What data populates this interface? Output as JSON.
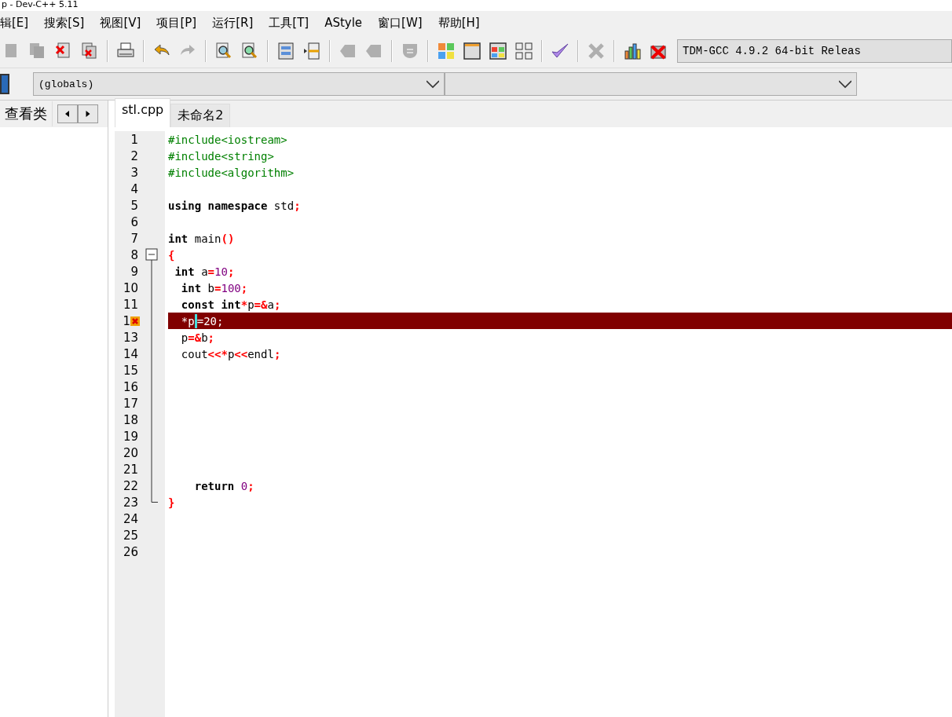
{
  "window": {
    "title": "p - Dev-C++ 5.11"
  },
  "menu": [
    "辑[E]",
    "搜索[S]",
    "视图[V]",
    "项目[P]",
    "运行[R]",
    "工具[T]",
    "AStyle",
    "窗口[W]",
    "帮助[H]"
  ],
  "toolbar": [
    {
      "kind": "page",
      "disabled": true
    },
    {
      "kind": "pages",
      "disabled": true
    },
    {
      "kind": "close-page",
      "disabled": false
    },
    {
      "kind": "close-pages",
      "disabled": false
    },
    {
      "kind": "sep"
    },
    {
      "kind": "printer",
      "disabled": false
    },
    {
      "kind": "sep"
    },
    {
      "kind": "undo",
      "disabled": false
    },
    {
      "kind": "redo",
      "disabled": true
    },
    {
      "kind": "sep"
    },
    {
      "kind": "search",
      "disabled": false
    },
    {
      "kind": "replace",
      "disabled": false
    },
    {
      "kind": "sep"
    },
    {
      "kind": "panels",
      "disabled": false
    },
    {
      "kind": "unindent",
      "disabled": false
    },
    {
      "kind": "sep"
    },
    {
      "kind": "tag",
      "disabled": true
    },
    {
      "kind": "tag",
      "disabled": true
    },
    {
      "kind": "sep"
    },
    {
      "kind": "shield",
      "disabled": true
    },
    {
      "kind": "sep"
    },
    {
      "kind": "tiles",
      "disabled": false
    },
    {
      "kind": "window",
      "disabled": false
    },
    {
      "kind": "color-tiles",
      "disabled": false
    },
    {
      "kind": "grid",
      "disabled": false
    },
    {
      "kind": "sep"
    },
    {
      "kind": "check",
      "disabled": false
    },
    {
      "kind": "sep"
    },
    {
      "kind": "cross",
      "disabled": true
    },
    {
      "kind": "sep"
    },
    {
      "kind": "chart",
      "disabled": false
    },
    {
      "kind": "stop",
      "disabled": false
    }
  ],
  "compiler": "TDM-GCC 4.9.2 64-bit Releas",
  "scope_combo": "(globals)",
  "left_panel": {
    "tab": "查看类"
  },
  "editor_tabs": [
    {
      "label": "stl.cpp",
      "selected": true
    },
    {
      "label": "未命名2",
      "selected": false
    }
  ],
  "lines": [
    {
      "number": "1",
      "tokens": [
        {
          "kind": "pre",
          "text": "#include<iostream>"
        }
      ]
    },
    {
      "number": "2",
      "tokens": [
        {
          "kind": "pre",
          "text": "#include<string>"
        }
      ]
    },
    {
      "number": "3",
      "tokens": [
        {
          "kind": "pre",
          "text": "#include<algorithm>"
        }
      ]
    },
    {
      "number": "4"
    },
    {
      "number": "5",
      "tokens": [
        {
          "kind": "kw",
          "text": "using namespace"
        },
        {
          "kind": "id",
          "text": " std"
        },
        {
          "kind": "op",
          "text": ";"
        }
      ]
    },
    {
      "number": "6"
    },
    {
      "number": "7",
      "tokens": [
        {
          "kind": "kw",
          "text": "int"
        },
        {
          "kind": "id",
          "text": " main"
        },
        {
          "kind": "op",
          "text": "()"
        }
      ]
    },
    {
      "number": "8",
      "fold_start": true,
      "tokens": [
        {
          "kind": "op",
          "text": "{"
        }
      ]
    },
    {
      "number": "9",
      "tokens": [
        {
          "kind": "kw",
          "text": " int"
        },
        {
          "kind": "id",
          "text": " a"
        },
        {
          "kind": "op",
          "text": "="
        },
        {
          "kind": "num",
          "text": "10"
        },
        {
          "kind": "op",
          "text": ";"
        }
      ]
    },
    {
      "number": "10",
      "tokens": [
        {
          "kind": "kw",
          "text": "  int"
        },
        {
          "kind": "id",
          "text": " b"
        },
        {
          "kind": "op",
          "text": "="
        },
        {
          "kind": "num",
          "text": "100"
        },
        {
          "kind": "op",
          "text": ";"
        }
      ]
    },
    {
      "number": "11",
      "tokens": [
        {
          "kind": "kw",
          "text": "  const int"
        },
        {
          "kind": "op",
          "text": "*"
        },
        {
          "kind": "id",
          "text": "p"
        },
        {
          "kind": "op",
          "text": "=&"
        },
        {
          "kind": "id",
          "text": "a"
        },
        {
          "kind": "op",
          "text": ";"
        }
      ]
    },
    {
      "number": "1",
      "error": true,
      "tokens": [
        {
          "kind": "id",
          "text": "  *p"
        },
        {
          "kind": "caret"
        },
        {
          "kind": "id",
          "text": "=20;"
        }
      ]
    },
    {
      "number": "13",
      "tokens": [
        {
          "kind": "id",
          "text": "  p"
        },
        {
          "kind": "op",
          "text": "=&"
        },
        {
          "kind": "id",
          "text": "b"
        },
        {
          "kind": "op",
          "text": ";"
        }
      ]
    },
    {
      "number": "14",
      "tokens": [
        {
          "kind": "id",
          "text": "  cout"
        },
        {
          "kind": "op",
          "text": "<<*"
        },
        {
          "kind": "id",
          "text": "p"
        },
        {
          "kind": "op",
          "text": "<<"
        },
        {
          "kind": "id",
          "text": "endl"
        },
        {
          "kind": "op",
          "text": ";"
        }
      ]
    },
    {
      "number": "15"
    },
    {
      "number": "16"
    },
    {
      "number": "17"
    },
    {
      "number": "18"
    },
    {
      "number": "19"
    },
    {
      "number": "20"
    },
    {
      "number": "21"
    },
    {
      "number": "22",
      "tokens": [
        {
          "kind": "kw",
          "text": "    return "
        },
        {
          "kind": "num",
          "text": "0"
        },
        {
          "kind": "op",
          "text": ";"
        }
      ]
    },
    {
      "number": "23",
      "fold_end": true,
      "tokens": [
        {
          "kind": "op",
          "text": "}"
        }
      ]
    },
    {
      "number": "24"
    },
    {
      "number": "25"
    },
    {
      "number": "26"
    }
  ]
}
